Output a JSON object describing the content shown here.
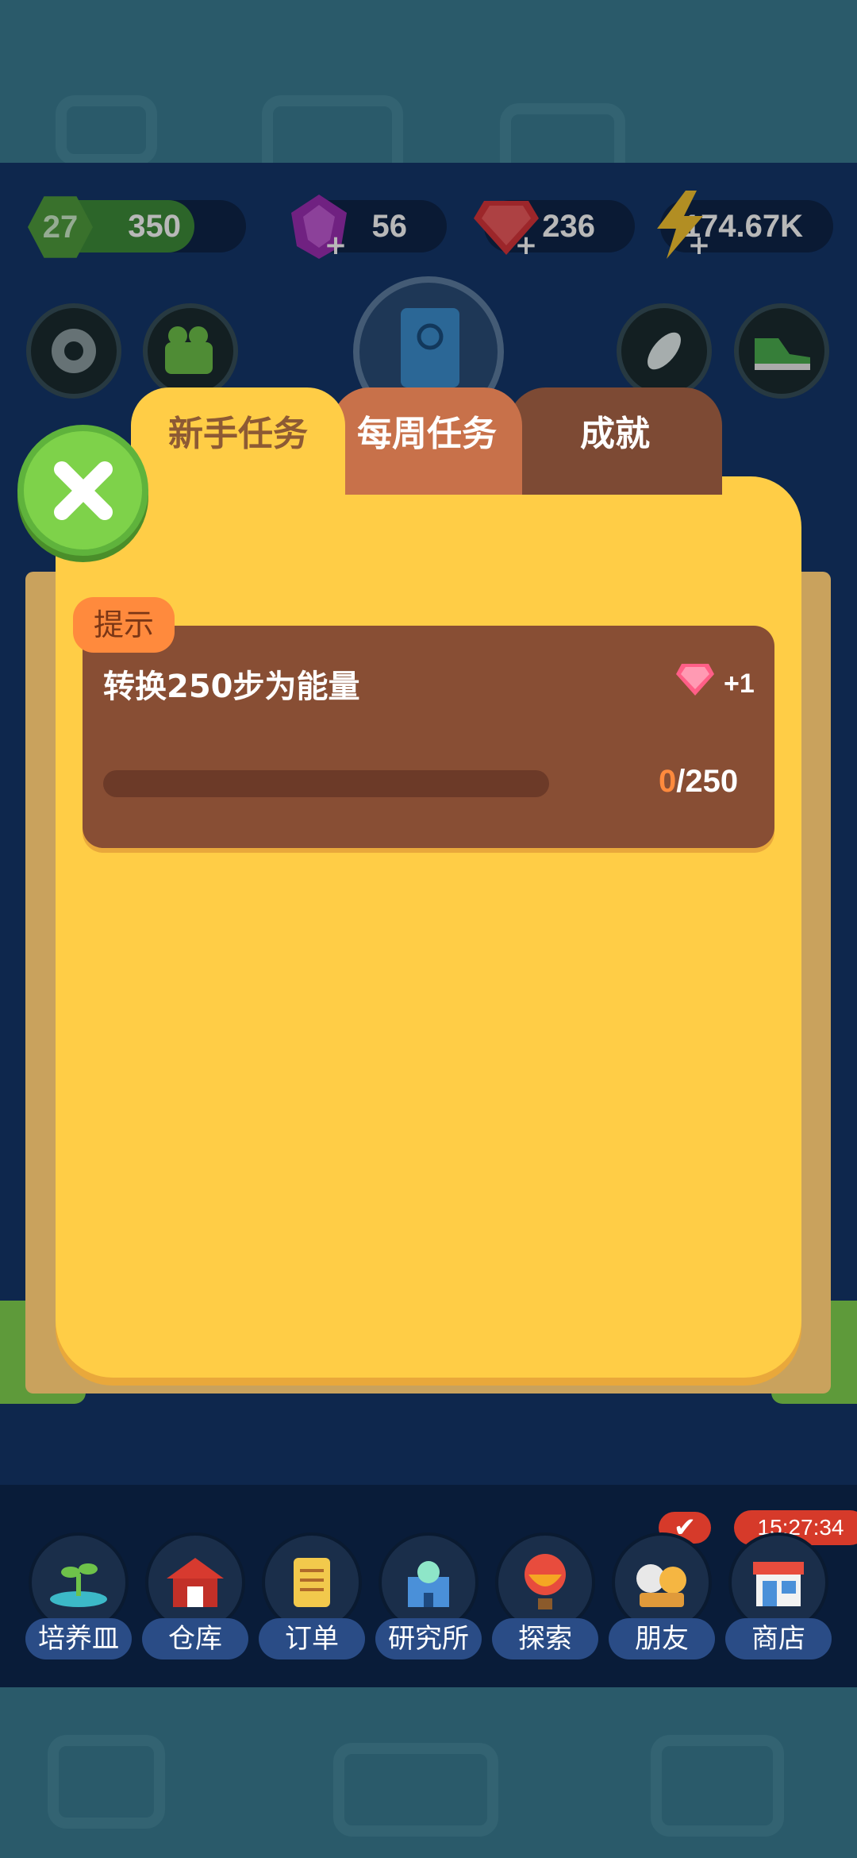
{
  "resources": {
    "level": "27",
    "coins": "350",
    "purple_gems": "56",
    "red_gems": "236",
    "energy": "174.67K"
  },
  "dialog": {
    "tabs": [
      {
        "label": "新手任务",
        "active": true
      },
      {
        "label": "每周任务",
        "active": false
      },
      {
        "label": "成就",
        "active": false
      }
    ],
    "task": {
      "hint_label": "提示",
      "title": "转换250步为能量",
      "reward": "+1",
      "progress_current": "0",
      "progress_total": "/250",
      "progress_fraction": 0
    }
  },
  "badges": {
    "check": "✔",
    "timer": "15:27:34"
  },
  "bottom_nav": [
    {
      "label": "培养皿",
      "icon": "sprout-icon"
    },
    {
      "label": "仓库",
      "icon": "barn-icon"
    },
    {
      "label": "订单",
      "icon": "scroll-icon"
    },
    {
      "label": "研究所",
      "icon": "lab-icon"
    },
    {
      "label": "探索",
      "icon": "balloon-icon"
    },
    {
      "label": "朋友",
      "icon": "friends-icon"
    },
    {
      "label": "商店",
      "icon": "shop-icon"
    }
  ],
  "colors": {
    "panel": "#ffcd46",
    "card": "#884e34",
    "accent_orange": "#ff8a3d",
    "close_green": "#7ed24a"
  }
}
